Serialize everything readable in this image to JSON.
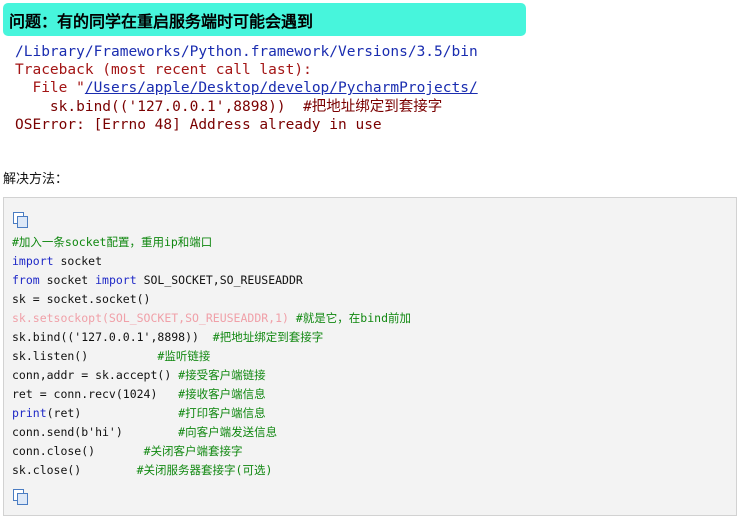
{
  "question_banner": "问题：有的同学在重启服务端时可能会遇到",
  "traceback": {
    "path_line": "/Library/Frameworks/Python.framework/Versions/3.5/bin",
    "header": "Traceback (most recent call last):",
    "file_prefix": "  File \"",
    "file_link": "/Users/apple/Desktop/develop/PycharmProjects/",
    "code_line": "    sk.bind(('127.0.0.1',8898))  #把地址绑定到套接字",
    "error_line": "OSError: [Errno 48] Address already in use"
  },
  "solution_label": "解决方法：",
  "code_block": {
    "icon_top": "copy-icon",
    "icon_bottom": "copy-icon",
    "lines": {
      "l1_comment": "#加入一条socket配置，重用ip和端口",
      "l2_kw": "import",
      "l2_rest": " socket",
      "l3_kw1": "from",
      "l3_mid": " socket ",
      "l3_kw2": "import",
      "l3_rest": " SOL_SOCKET,SO_REUSEADDR",
      "l4": "sk = socket.socket()",
      "l5_code": "sk.setsockopt(SOL_SOCKET,SO_REUSEADDR,1)",
      "l5_comment": " #就是它，在bind前加",
      "l6_code": "sk.bind(('127.0.0.1',8898))  ",
      "l6_comment": "#把地址绑定到套接字",
      "l7_code": "sk.listen()          ",
      "l7_comment": "#监听链接",
      "l8_code": "conn,addr = sk.accept() ",
      "l8_comment": "#接受客户端链接",
      "l9_code": "ret = conn.recv(1024)   ",
      "l9_comment": "#接收客户端信息",
      "l10_kw": "print",
      "l10_code": "(ret)              ",
      "l10_comment": "#打印客户端信息",
      "l11_code": "conn.send(b'hi')        ",
      "l11_comment": "#向客户端发送信息",
      "l12_code": "conn.close()       ",
      "l12_comment": "#关闭客户端套接字",
      "l13_code": "sk.close()        ",
      "l13_comment": "#关闭服务器套接字(可选)"
    }
  }
}
